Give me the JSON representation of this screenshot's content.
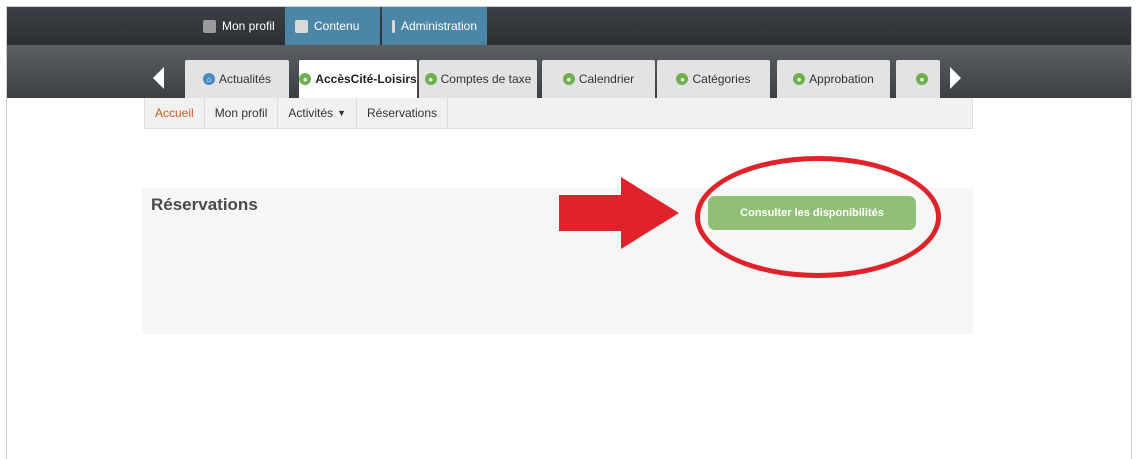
{
  "admin_bar": {
    "items": [
      {
        "label": "Mon profil",
        "icon": "user-icon"
      },
      {
        "label": "Contenu",
        "icon": "document-icon"
      },
      {
        "label": "Administration",
        "icon": "grid-icon"
      }
    ],
    "active_color": "#4b86a6"
  },
  "tabs": [
    {
      "label": "Actualités",
      "icon": "home-icon"
    },
    {
      "label": "AccèsCité-Loisirs",
      "icon": "leaf-icon"
    },
    {
      "label": "Comptes de taxe",
      "icon": "leaf-icon"
    },
    {
      "label": "Calendrier",
      "icon": "leaf-icon"
    },
    {
      "label": "Catégories",
      "icon": "leaf-icon"
    },
    {
      "label": "Approbation",
      "icon": "leaf-icon"
    }
  ],
  "subnav": {
    "items": [
      {
        "label": "Accueil"
      },
      {
        "label": "Mon profil"
      },
      {
        "label": "Activités"
      },
      {
        "label": "Réservations"
      }
    ],
    "current_color": "#d45a1f"
  },
  "panel": {
    "title": "Réservations",
    "button_label": "Consulter les disponibilités",
    "button_color": "#92bf76"
  },
  "annotation": {
    "color": "#e0222a"
  }
}
